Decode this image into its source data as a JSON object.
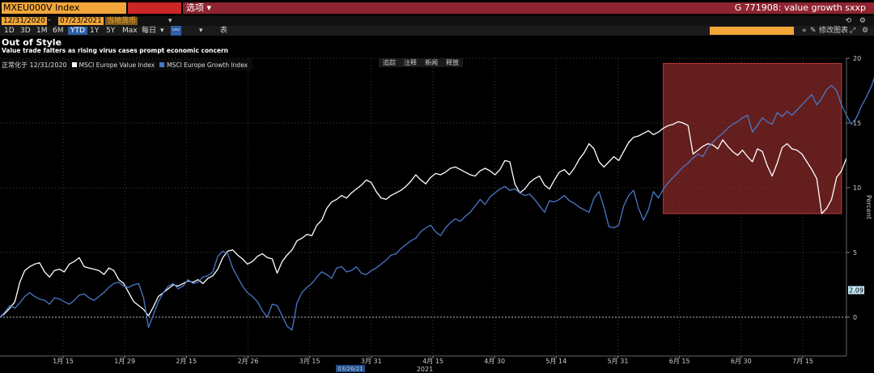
{
  "header": {
    "security": "MXEU000V Index",
    "options_label": "选项",
    "chart_title": "G 771908: value growth sxxp"
  },
  "toolbar": {
    "start_date": "12/31/2020",
    "end_date": "07/23/2021",
    "currency": "当地货币",
    "ranges": [
      "1D",
      "3D",
      "1M",
      "6M",
      "YTD",
      "1Y",
      "5Y",
      "Max"
    ],
    "active_range": "YTD",
    "frequency": "每日",
    "table_label": "表",
    "edit_chart_label": "修改图表"
  },
  "chart_tools": [
    "追踪",
    "注释",
    "新闻",
    "释放"
  ],
  "chart_data": {
    "type": "line",
    "title": "Out of Style",
    "subtitle": "Value trade falters as rising virus cases prompt economic concern",
    "normalized_label": "正常化于 12/31/2020",
    "ylabel": "Percent",
    "ylim": [
      -3,
      20
    ],
    "yticks": [
      0,
      5,
      10,
      15,
      20
    ],
    "x_tick_labels": [
      "1月 15",
      "1月 29",
      "2月 15",
      "2月 26",
      "3月 15",
      "3月 31",
      "4月 15",
      "4月 30",
      "5月 14",
      "5月 31",
      "6月 15",
      "6月 30",
      "7月 15"
    ],
    "x_year_label": "2021",
    "highlight_date": "03/26/21",
    "last_value_label": "2.09",
    "highlight_region": {
      "x_from": 134,
      "x_to": 170,
      "y_from": 8,
      "y_to": 19.6
    },
    "series": [
      {
        "name": "MSCI Europe Value Index",
        "color": "#ffffff",
        "values": [
          0,
          0.3,
          0.7,
          1.2,
          2.7,
          3.6,
          3.9,
          4.1,
          4.2,
          3.5,
          3.1,
          3.6,
          3.7,
          3.5,
          4.1,
          4.3,
          4.6,
          3.9,
          3.8,
          3.7,
          3.6,
          3.3,
          3.8,
          3.6,
          2.9,
          2.6,
          1.9,
          1.2,
          0.9,
          0.6,
          0.1,
          0.8,
          1.6,
          1.9,
          2.2,
          2.5,
          2.4,
          2.6,
          2.8,
          2.7,
          2.9,
          2.6,
          3.0,
          3.2,
          3.7,
          4.6,
          5.1,
          5.2,
          4.8,
          4.5,
          4.1,
          4.3,
          4.7,
          4.9,
          4.6,
          4.5,
          3.4,
          4.3,
          4.8,
          5.2,
          5.9,
          6.1,
          6.4,
          6.3,
          7.1,
          7.5,
          8.4,
          8.9,
          9.1,
          9.4,
          9.2,
          9.6,
          9.9,
          10.2,
          10.6,
          10.4,
          9.7,
          9.2,
          9.1,
          9.4,
          9.6,
          9.8,
          10.1,
          10.5,
          11.0,
          10.6,
          10.3,
          10.8,
          11.1,
          11.0,
          11.2,
          11.5,
          11.6,
          11.4,
          11.2,
          11.0,
          10.9,
          11.3,
          11.5,
          11.3,
          11.0,
          11.4,
          12.1,
          12.0,
          10.3,
          9.6,
          9.9,
          10.4,
          10.7,
          10.9,
          10.2,
          9.9,
          10.6,
          11.2,
          11.4,
          11.0,
          11.5,
          12.2,
          12.7,
          13.4,
          13.0,
          12.0,
          11.6,
          12.0,
          12.4,
          12.1,
          12.8,
          13.5,
          13.9,
          14.0,
          14.2,
          14.4,
          14.1,
          14.3,
          14.6,
          14.8,
          14.9,
          15.1,
          15.0,
          14.8,
          12.6,
          12.9,
          13.2,
          13.4,
          13.3,
          13.0,
          13.7,
          13.2,
          12.8,
          12.5,
          12.9,
          12.4,
          12.0,
          13.0,
          12.8,
          11.7,
          10.9,
          11.9,
          13.1,
          13.4,
          13.0,
          12.9,
          12.6,
          12.0,
          11.4,
          10.7,
          8.0,
          8.4,
          9.1,
          10.8,
          11.3,
          12.3
        ]
      },
      {
        "name": "MSCI Europe Growth Index",
        "color": "#4a78c8",
        "values": [
          0,
          0.4,
          0.9,
          0.7,
          1.1,
          1.6,
          1.9,
          1.6,
          1.4,
          1.3,
          1.0,
          1.5,
          1.4,
          1.2,
          1.0,
          1.3,
          1.7,
          1.8,
          1.5,
          1.3,
          1.6,
          1.9,
          2.3,
          2.6,
          2.7,
          2.4,
          2.3,
          2.5,
          2.6,
          1.5,
          -0.8,
          0.2,
          1.2,
          1.9,
          2.4,
          2.6,
          2.2,
          2.4,
          2.9,
          2.6,
          2.7,
          3.1,
          3.2,
          3.5,
          4.7,
          5.1,
          4.9,
          3.8,
          3.1,
          2.4,
          1.9,
          1.6,
          1.2,
          0.5,
          0.0,
          1.0,
          0.9,
          0.1,
          -0.7,
          -1.0,
          1.1,
          1.9,
          2.3,
          2.6,
          3.1,
          3.5,
          3.3,
          3.0,
          3.8,
          3.9,
          3.5,
          3.6,
          3.9,
          3.4,
          3.3,
          3.6,
          3.8,
          4.1,
          4.4,
          4.8,
          4.9,
          5.3,
          5.6,
          5.9,
          6.1,
          6.6,
          6.9,
          7.1,
          6.6,
          6.3,
          6.9,
          7.3,
          7.6,
          7.4,
          7.8,
          8.1,
          8.6,
          9.1,
          8.7,
          9.3,
          9.6,
          9.9,
          10.1,
          9.8,
          9.9,
          9.6,
          9.4,
          9.5,
          9.1,
          8.6,
          8.1,
          9.0,
          8.9,
          9.1,
          9.4,
          9.0,
          8.8,
          8.5,
          8.3,
          8.1,
          9.2,
          9.7,
          8.5,
          7.0,
          6.9,
          7.1,
          8.6,
          9.4,
          9.8,
          8.4,
          7.5,
          8.3,
          9.7,
          9.2,
          9.9,
          10.4,
          10.8,
          11.2,
          11.6,
          11.9,
          12.3,
          12.6,
          12.4,
          13.1,
          13.5,
          13.9,
          14.2,
          14.6,
          14.9,
          15.1,
          15.4,
          15.6,
          14.3,
          14.8,
          15.4,
          15.1,
          14.9,
          15.8,
          15.5,
          15.9,
          15.6,
          16.0,
          16.4,
          16.8,
          17.2,
          16.4,
          16.9,
          17.6,
          17.9,
          17.5,
          16.4,
          15.6,
          14.9,
          15.4,
          16.3,
          17.0,
          17.8,
          18.9
        ]
      }
    ]
  }
}
